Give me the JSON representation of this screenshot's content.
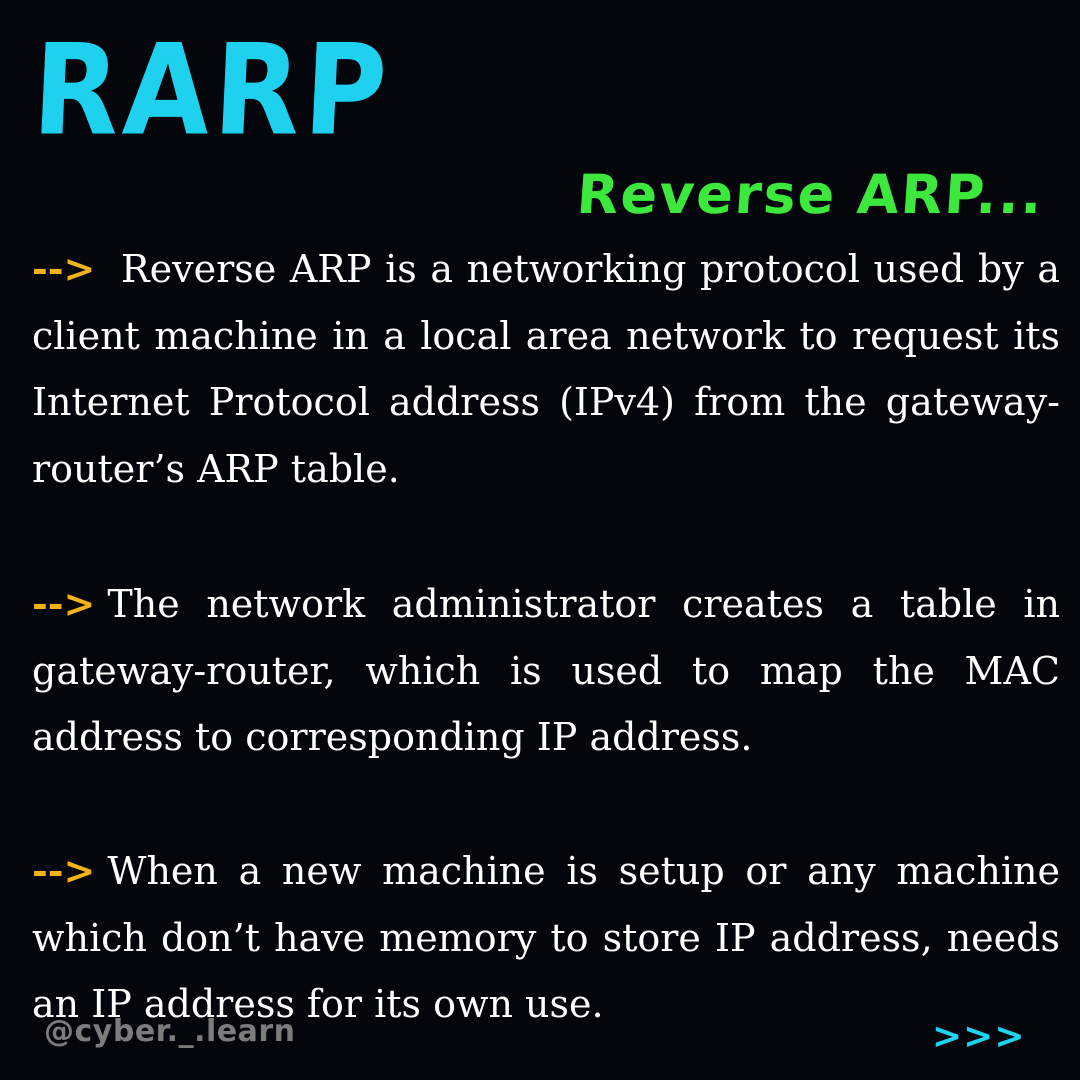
{
  "title": "RARP",
  "subtitle": "Reverse ARP...",
  "paragraphs": [
    {
      "arrow": "-->",
      "text": "Reverse ARP is a networking protocol used by a client machine in a local area network to request its Internet Protocol address (IPv4) from the gateway-router’s ARP table."
    },
    {
      "arrow": "-->",
      "text": "The network administrator creates a table in gateway-router, which is used to map the MAC address to corresponding IP address."
    },
    {
      "arrow": "-->",
      "text": "When a new machine is setup or any machine which don’t have memory to store IP address, needs an IP address for its own use."
    }
  ],
  "footer": {
    "handle": "@cyber._.learn",
    "next": ">>>"
  },
  "colors": {
    "background": "#04060b",
    "title": "#1ed1ef",
    "subtitle": "#3ce83c",
    "arrow": "#f2b21a",
    "body_text": "#ffffff",
    "handle": "#7c7c7c",
    "next": "#1ed1ef"
  }
}
